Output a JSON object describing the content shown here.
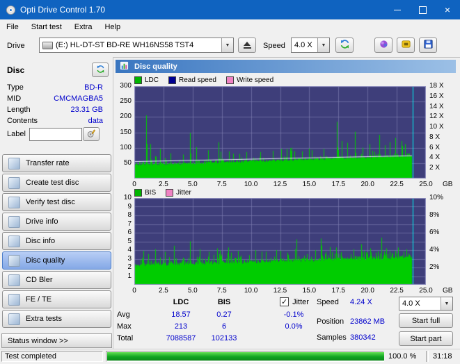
{
  "window": {
    "title": "Opti Drive Control 1.70"
  },
  "menu": {
    "items": [
      "File",
      "Start test",
      "Extra",
      "Help"
    ]
  },
  "toolbar": {
    "drive_label": "Drive",
    "drive_value": "(E:)   HL-DT-ST BD-RE  WH16NS58 TST4",
    "speed_label": "Speed",
    "speed_value": "4.0 X"
  },
  "sidebar": {
    "disc_header": "Disc",
    "info": [
      {
        "label": "Type",
        "value": "BD-R"
      },
      {
        "label": "MID",
        "value": "CMCMAGBA5"
      },
      {
        "label": "Length",
        "value": "23.31 GB"
      },
      {
        "label": "Contents",
        "value": "data"
      }
    ],
    "label_caption": "Label",
    "label_value": "",
    "buttons": [
      "Transfer rate",
      "Create test disc",
      "Verify test disc",
      "Drive info",
      "Disc info",
      "Disc quality",
      "CD Bler",
      "FE / TE",
      "Extra tests"
    ],
    "active_button": "Disc quality",
    "status_window_label": "Status window >>"
  },
  "main": {
    "header": "Disc quality"
  },
  "stats": {
    "col_ldc": "LDC",
    "col_bis": "BIS",
    "jitter_label": "Jitter",
    "jitter_checked": true,
    "rows": [
      {
        "label": "Avg",
        "ldc": "18.57",
        "bis": "0.27",
        "jitter": "-0.1%"
      },
      {
        "label": "Max",
        "ldc": "213",
        "bis": "6",
        "jitter": "0.0%"
      },
      {
        "label": "Total",
        "ldc": "7088587",
        "bis": "102133",
        "jitter": ""
      }
    ],
    "speed_label": "Speed",
    "speed_value": "4.24 X",
    "speed_select": "4.0 X",
    "position_label": "Position",
    "position_value": "23862 MB",
    "samples_label": "Samples",
    "samples_value": "380342",
    "start_full": "Start full",
    "start_part": "Start part"
  },
  "statusbar": {
    "status": "Test completed",
    "percent": "100.0 %",
    "progress": 100,
    "time": "31:18"
  },
  "chart_data": [
    {
      "type": "area",
      "title": "LDC errors vs disc position",
      "series_name": "LDC",
      "legend": [
        {
          "label": "LDC",
          "color": "#00b400"
        },
        {
          "label": "Read speed",
          "color": "#000091"
        },
        {
          "label": "Write speed",
          "color": "#ef82c3"
        }
      ],
      "x_max_gb": 25.0,
      "x_unit": "GB",
      "x_ticks": [
        {
          "label": "0",
          "gb": 0
        },
        {
          "label": "2.5",
          "gb": 2.5
        },
        {
          "label": "5.0",
          "gb": 5
        },
        {
          "label": "7.5",
          "gb": 7.5
        },
        {
          "label": "10.0",
          "gb": 10
        },
        {
          "label": "12.5",
          "gb": 12.5
        },
        {
          "label": "15.0",
          "gb": 15
        },
        {
          "label": "17.5",
          "gb": 17.5
        },
        {
          "label": "20.0",
          "gb": 20
        },
        {
          "label": "22.5",
          "gb": 22.5
        },
        {
          "label": "25.0",
          "gb": 25
        }
      ],
      "y_left_max": 300,
      "y_left_ticks": [
        {
          "label": "300",
          "f": 1
        },
        {
          "label": "250",
          "f": 0.8333
        },
        {
          "label": "200",
          "f": 0.6667
        },
        {
          "label": "150",
          "f": 0.5
        },
        {
          "label": "100",
          "f": 0.3333
        },
        {
          "label": "50",
          "f": 0.1667
        }
      ],
      "y_right_ticks": [
        {
          "label": "18 X",
          "f": 1
        },
        {
          "label": "16 X",
          "f": 0.8889
        },
        {
          "label": "14 X",
          "f": 0.7778
        },
        {
          "label": "12 X",
          "f": 0.6667
        },
        {
          "label": "10 X",
          "f": 0.5556
        },
        {
          "label": "8 X",
          "f": 0.4444
        },
        {
          "label": "6 X",
          "f": 0.3333
        },
        {
          "label": "4 X",
          "f": 0.2222
        },
        {
          "label": "2 X",
          "f": 0.1111
        }
      ],
      "baseline": {
        "start": 40,
        "end": 70,
        "noise": 16
      },
      "spikes": [
        [
          1.0,
          205
        ],
        [
          1.35,
          112
        ],
        [
          2.2,
          96
        ],
        [
          3.1,
          82
        ],
        [
          4.15,
          78
        ],
        [
          4.8,
          148
        ],
        [
          5.3,
          102
        ],
        [
          6.3,
          92
        ],
        [
          7.2,
          118
        ],
        [
          8.1,
          88
        ],
        [
          9.0,
          80
        ],
        [
          9.6,
          86
        ],
        [
          10.8,
          86
        ],
        [
          11.9,
          90
        ],
        [
          12.6,
          96
        ],
        [
          13.5,
          100
        ],
        [
          14.4,
          88
        ],
        [
          15.2,
          92
        ],
        [
          16.2,
          96
        ],
        [
          17.35,
          184
        ],
        [
          17.8,
          122
        ],
        [
          18.9,
          152
        ],
        [
          19.6,
          100
        ],
        [
          20.15,
          112
        ],
        [
          21.0,
          142
        ],
        [
          21.5,
          108
        ],
        [
          21.9,
          118
        ],
        [
          22.4,
          132
        ],
        [
          22.9,
          122
        ],
        [
          23.2,
          112
        ]
      ],
      "overlay_line": {
        "name": "read-speed",
        "color": "#e8e8ff",
        "start_v": 55,
        "end_v": 74
      },
      "data_end_gb": 23.8,
      "position_line_gb": 23.86,
      "avg": "18.57",
      "max": "213",
      "total": "7088587",
      "colors": {
        "bg": "#3e3e7a",
        "grid": "#8080b2",
        "series": "#00cc00",
        "position": "#00f0f0"
      },
      "seed": 7
    },
    {
      "type": "area",
      "title": "BIS errors / Jitter vs disc position",
      "series_name": "BIS",
      "legend": [
        {
          "label": "BIS",
          "color": "#00b400"
        },
        {
          "label": "Jitter",
          "color": "#ef82c3"
        }
      ],
      "x_max_gb": 25.0,
      "x_unit": "GB",
      "x_ticks": [
        {
          "label": "0",
          "gb": 0
        },
        {
          "label": "2.5",
          "gb": 2.5
        },
        {
          "label": "5.0",
          "gb": 5
        },
        {
          "label": "7.5",
          "gb": 7.5
        },
        {
          "label": "10.0",
          "gb": 10
        },
        {
          "label": "12.5",
          "gb": 12.5
        },
        {
          "label": "15.0",
          "gb": 15
        },
        {
          "label": "17.5",
          "gb": 17.5
        },
        {
          "label": "20.0",
          "gb": 20
        },
        {
          "label": "22.5",
          "gb": 22.5
        },
        {
          "label": "25.0",
          "gb": 25
        }
      ],
      "y_left_max": 10,
      "y_left_ticks": [
        {
          "label": "10",
          "f": 1
        },
        {
          "label": "9",
          "f": 0.9
        },
        {
          "label": "8",
          "f": 0.8
        },
        {
          "label": "7",
          "f": 0.7
        },
        {
          "label": "6",
          "f": 0.6
        },
        {
          "label": "5",
          "f": 0.5
        },
        {
          "label": "4",
          "f": 0.4
        },
        {
          "label": "3",
          "f": 0.3
        },
        {
          "label": "2",
          "f": 0.2
        },
        {
          "label": "1",
          "f": 0.1
        }
      ],
      "y_right_ticks": [
        {
          "label": "10%",
          "f": 1
        },
        {
          "label": "8%",
          "f": 0.8
        },
        {
          "label": "6%",
          "f": 0.6
        },
        {
          "label": "4%",
          "f": 0.4
        },
        {
          "label": "2%",
          "f": 0.2
        }
      ],
      "baseline": {
        "start": 2.1,
        "end": 3.0,
        "noise": 1.0
      },
      "spikes": [
        [
          0.8,
          3.9
        ],
        [
          1.8,
          4.1
        ],
        [
          2.6,
          3.8
        ],
        [
          3.4,
          4.5
        ],
        [
          4.8,
          5.0
        ],
        [
          5.6,
          4.1
        ],
        [
          6.4,
          3.8
        ],
        [
          7.1,
          4.2
        ],
        [
          8.0,
          3.7
        ],
        [
          8.9,
          3.9
        ],
        [
          10.4,
          4.0
        ],
        [
          11.3,
          3.8
        ],
        [
          12.2,
          4.0
        ],
        [
          13.1,
          3.7
        ],
        [
          13.8,
          4.1
        ],
        [
          15.5,
          4.0
        ],
        [
          16.4,
          3.8
        ],
        [
          17.3,
          4.3
        ],
        [
          18.8,
          4.1
        ],
        [
          19.7,
          3.9
        ],
        [
          20.2,
          4.2
        ],
        [
          21.6,
          4.2
        ],
        [
          22.6,
          4.3
        ],
        [
          23.3,
          4.1
        ]
      ],
      "data_end_gb": 23.8,
      "position_line_gb": 23.86,
      "avg": "0.27",
      "max": "6",
      "total": "102133",
      "colors": {
        "bg": "#3e3e7a",
        "grid": "#8080b2",
        "series": "#00cc00",
        "position": "#00f0f0"
      },
      "seed": 11
    }
  ]
}
